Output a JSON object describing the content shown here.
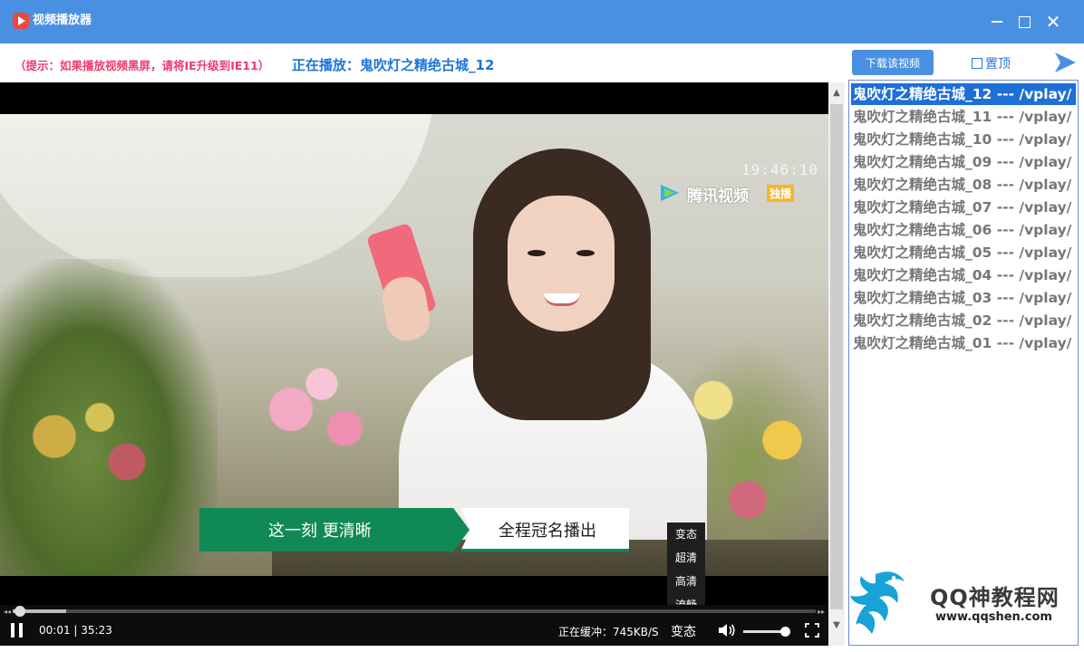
{
  "window": {
    "title": "视频播放器",
    "close_glyph": "✕"
  },
  "info_bar": {
    "tip": "（提示：如果播放视频黑屏，请将IE升级到IE11）",
    "now_playing": "正在播放：鬼吹灯之精绝古城_12",
    "download_label": "下载该视频",
    "pin_label": "置顶"
  },
  "video": {
    "timestamp": "19:46:10",
    "watermark": "腾讯视频",
    "watermark_badge": "独播",
    "banner_left": "这一刻 更清晰",
    "banner_right": "全程冠名播出"
  },
  "quality_menu": [
    "变态",
    "超清",
    "高清",
    "流畅"
  ],
  "controls": {
    "time": "00:01 | 35:23",
    "buffer": "正在缓冲：745KB/S",
    "quality_current": "变态",
    "progress": 0.009,
    "buffered": 0.067,
    "volume": 1.0
  },
  "scrollbar": {
    "up_glyph": "▲",
    "down_glyph": "▼"
  },
  "playlist": [
    {
      "label": "鬼吹灯之精绝古城_12 --- /vplay/",
      "active": true
    },
    {
      "label": "鬼吹灯之精绝古城_11 --- /vplay/",
      "active": false
    },
    {
      "label": "鬼吹灯之精绝古城_10 --- /vplay/",
      "active": false
    },
    {
      "label": "鬼吹灯之精绝古城_09 --- /vplay/",
      "active": false
    },
    {
      "label": "鬼吹灯之精绝古城_08 --- /vplay/",
      "active": false
    },
    {
      "label": "鬼吹灯之精绝古城_07 --- /vplay/",
      "active": false
    },
    {
      "label": "鬼吹灯之精绝古城_06 --- /vplay/",
      "active": false
    },
    {
      "label": "鬼吹灯之精绝古城_05 --- /vplay/",
      "active": false
    },
    {
      "label": "鬼吹灯之精绝古城_04 --- /vplay/",
      "active": false
    },
    {
      "label": "鬼吹灯之精绝古城_03 --- /vplay/",
      "active": false
    },
    {
      "label": "鬼吹灯之精绝古城_02 --- /vplay/",
      "active": false
    },
    {
      "label": "鬼吹灯之精绝古城_01 --- /vplay/",
      "active": false
    }
  ],
  "site": {
    "name": "QQ神教程网",
    "url": "www.qqshen.com"
  },
  "colors": {
    "titlebar": "#4a90e2",
    "accent": "#1e6fd6",
    "tip": "#ee3b6e",
    "banner_green": "#0f8a55"
  },
  "icons": [
    "app-logo-icon",
    "minimize-icon",
    "maximize-icon",
    "close-icon",
    "arrow-right-icon",
    "pause-icon",
    "volume-icon",
    "fullscreen-icon",
    "dragon-logo-icon"
  ]
}
